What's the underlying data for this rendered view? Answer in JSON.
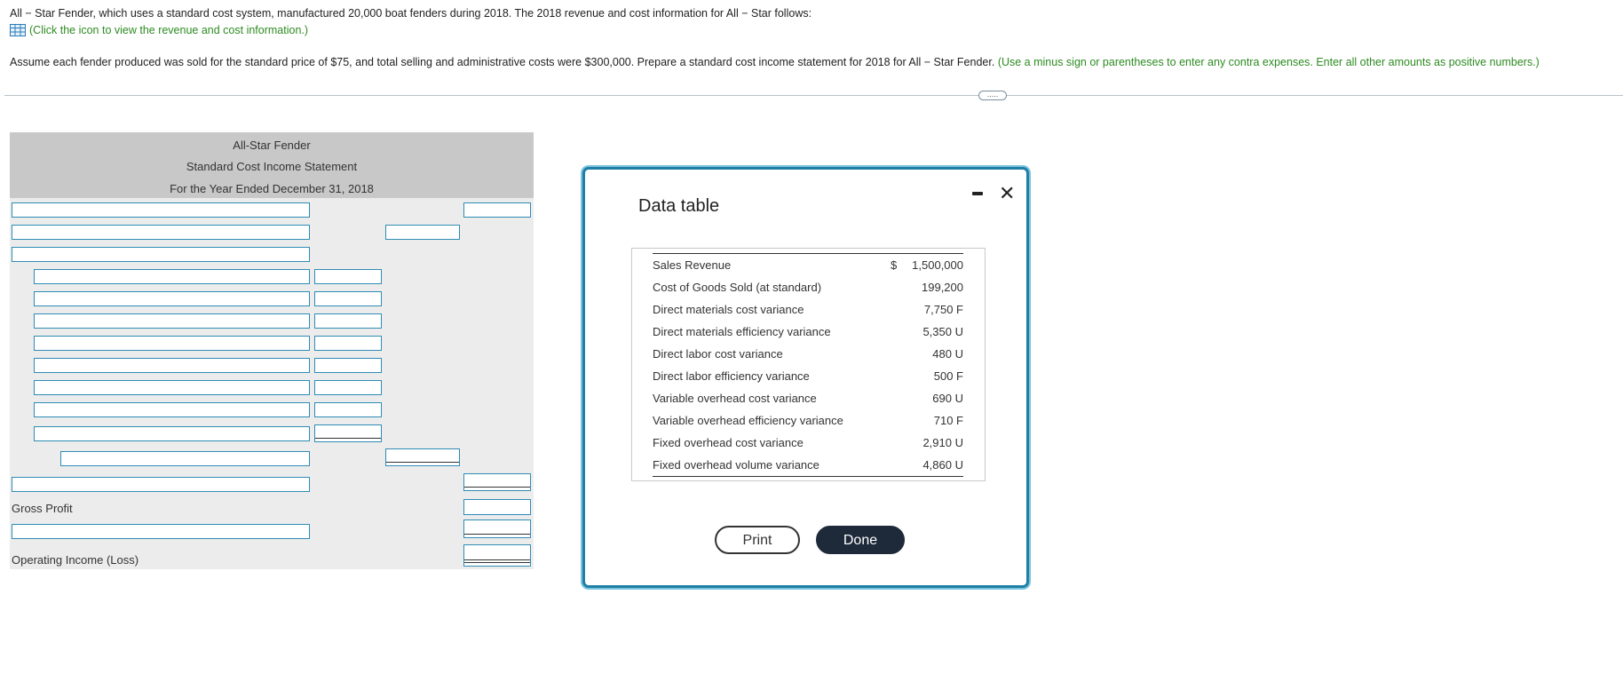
{
  "question": {
    "intro": "All − Star Fender, which uses a standard cost system, manufactured 20,000 boat fenders during 2018. The 2018 revenue and cost information for All − Star follows:",
    "link_text": "(Click the icon to view the revenue and cost information.)",
    "instruction": "Assume each fender produced was sold for the standard price of $75, and total selling and administrative costs were $300,000. Prepare a standard cost income statement for 2018 for All − Star Fender.",
    "hint": "(Use a minus sign or parentheses to enter any contra expenses. Enter all other amounts as positive numbers.)",
    "more_label": "....."
  },
  "statement": {
    "company": "All-Star Fender",
    "title": "Standard Cost Income Statement",
    "period": "For the Year Ended December 31, 2018",
    "gross_profit_label": "Gross Profit",
    "operating_income_label": "Operating Income (Loss)"
  },
  "dialog": {
    "title": "Data table",
    "minimize_icon": "minimize-icon",
    "close_icon": "close-icon",
    "close_glyph": "✕",
    "rows": [
      {
        "label": "Sales Revenue",
        "dollar": "$",
        "value": "1,500,000"
      },
      {
        "label": "Cost of Goods Sold (at standard)",
        "dollar": "",
        "value": "199,200"
      },
      {
        "label": "Direct materials cost variance",
        "dollar": "",
        "value": "7,750 F"
      },
      {
        "label": "Direct materials efficiency variance",
        "dollar": "",
        "value": "5,350 U"
      },
      {
        "label": "Direct labor cost variance",
        "dollar": "",
        "value": "480 U"
      },
      {
        "label": "Direct labor efficiency variance",
        "dollar": "",
        "value": "500 F"
      },
      {
        "label": "Variable overhead cost variance",
        "dollar": "",
        "value": "690 U"
      },
      {
        "label": "Variable overhead efficiency variance",
        "dollar": "",
        "value": "710 F"
      },
      {
        "label": "Fixed overhead cost variance",
        "dollar": "",
        "value": "2,910 U"
      },
      {
        "label": "Fixed overhead volume variance",
        "dollar": "",
        "value": "4,860 U"
      }
    ],
    "print_label": "Print",
    "done_label": "Done"
  },
  "colors": {
    "accent_green": "#2e8b22",
    "field_border": "#2e8cb5",
    "dialog_border": "#1f7fa6",
    "done_bg": "#1e2a3a"
  }
}
